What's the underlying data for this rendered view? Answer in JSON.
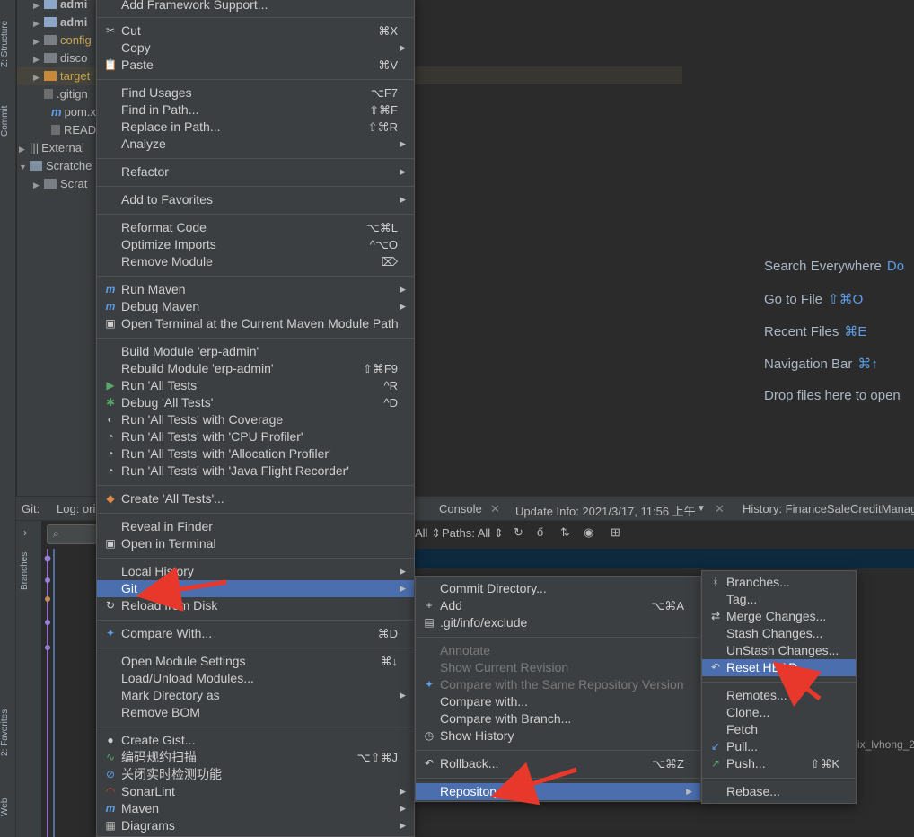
{
  "left_strip": {
    "structure_tab": "Z: Structure",
    "commit_tab": "Commit",
    "favorites_tab": "2: Favorites",
    "web_tab": "Web"
  },
  "tree": [
    {
      "label": "admi",
      "type": "module"
    },
    {
      "label": "admi",
      "type": "module"
    },
    {
      "label": "config",
      "type": "folder"
    },
    {
      "label": "disco",
      "type": "folder"
    },
    {
      "label": "target",
      "type": "folder"
    },
    {
      "label": ".gitign",
      "type": "file"
    },
    {
      "label": "pom.x",
      "type": "maven"
    },
    {
      "label": "READ",
      "type": "file"
    },
    {
      "label": "External",
      "type": "lib"
    },
    {
      "label": "Scratche",
      "type": "scratch"
    },
    {
      "label": "Scrat",
      "type": "folder"
    }
  ],
  "welcome": [
    {
      "label": "Search Everywhere",
      "shortcut": "Do"
    },
    {
      "label": "Go to File",
      "shortcut": "⇧⌘O"
    },
    {
      "label": "Recent Files",
      "shortcut": "⌘E"
    },
    {
      "label": "Navigation Bar",
      "shortcut": "⌘↑"
    },
    {
      "label": "Drop files here to open",
      "shortcut": ""
    }
  ],
  "bottom": {
    "git": "Git:",
    "log": "Log: ori",
    "console": "Console",
    "update_info": "Update Info: 2021/3/17, 11:56 上午",
    "history": "History: FinanceSaleCreditManag",
    "branches_tab": "Branches",
    "filter_all": "All",
    "paths": "Paths: All",
    "branch_label": "ix_lvhong_2"
  },
  "context_menu": {
    "header": "Add Framework Support...",
    "items": [
      {
        "label": "Cut",
        "shortcut": "⌘X",
        "icon": "✂"
      },
      {
        "label": "Copy",
        "submenu": true
      },
      {
        "label": "Paste",
        "shortcut": "⌘V",
        "icon": "📋"
      },
      {
        "label": "Find Usages",
        "shortcut": "⌥F7"
      },
      {
        "label": "Find in Path...",
        "shortcut": "⇧⌘F"
      },
      {
        "label": "Replace in Path...",
        "shortcut": "⇧⌘R"
      },
      {
        "label": "Analyze",
        "submenu": true
      },
      {
        "label": "Refactor",
        "submenu": true
      },
      {
        "label": "Add to Favorites",
        "submenu": true
      },
      {
        "label": "Reformat Code",
        "shortcut": "⌥⌘L"
      },
      {
        "label": "Optimize Imports",
        "shortcut": "^⌥O"
      },
      {
        "label": "Remove Module",
        "shortcut": "⌦"
      },
      {
        "label": "Run Maven",
        "submenu": true,
        "icon": "m"
      },
      {
        "label": "Debug Maven",
        "submenu": true,
        "icon": "m"
      },
      {
        "label": "Open Terminal at the Current Maven Module Path",
        "icon": "▣"
      },
      {
        "label": "Build Module 'erp-admin'"
      },
      {
        "label": "Rebuild Module 'erp-admin'",
        "shortcut": "⇧⌘F9"
      },
      {
        "label": "Run 'All Tests'",
        "shortcut": "^R",
        "icon": "▶"
      },
      {
        "label": "Debug 'All Tests'",
        "shortcut": "^D",
        "icon": "✱"
      },
      {
        "label": "Run 'All Tests' with Coverage",
        "icon": "◐"
      },
      {
        "label": "Run 'All Tests' with 'CPU Profiler'",
        "icon": "◔"
      },
      {
        "label": "Run 'All Tests' with 'Allocation Profiler'",
        "icon": "◔"
      },
      {
        "label": "Run 'All Tests' with 'Java Flight Recorder'",
        "icon": "◔"
      },
      {
        "label": "Create 'All Tests'...",
        "icon": "◆"
      },
      {
        "label": "Reveal in Finder"
      },
      {
        "label": "Open in Terminal",
        "icon": "▣"
      },
      {
        "label": "Local History",
        "submenu": true
      },
      {
        "label": "Git",
        "submenu": true,
        "selected": true
      },
      {
        "label": "Reload from Disk",
        "icon": "↻"
      },
      {
        "label": "Compare With...",
        "shortcut": "⌘D",
        "icon": "✦"
      },
      {
        "label": "Open Module Settings",
        "shortcut": "⌘↓"
      },
      {
        "label": "Load/Unload Modules..."
      },
      {
        "label": "Mark Directory as",
        "submenu": true
      },
      {
        "label": "Remove BOM"
      },
      {
        "label": "Create Gist...",
        "icon": "●"
      },
      {
        "label": "编码规约扫描",
        "shortcut": "⌥⇧⌘J",
        "icon": "∿"
      },
      {
        "label": "关闭实时检测功能",
        "icon": "⊘"
      },
      {
        "label": "SonarLint",
        "submenu": true,
        "icon": "◠"
      },
      {
        "label": "Maven",
        "submenu": true,
        "icon": "m"
      },
      {
        "label": "Diagrams",
        "submenu": true,
        "icon": "▦"
      }
    ]
  },
  "git_menu": {
    "items": [
      {
        "label": "Commit Directory..."
      },
      {
        "label": "Add",
        "shortcut": "⌥⌘A",
        "icon": "+"
      },
      {
        "label": ".git/info/exclude",
        "icon": "▤"
      },
      {
        "label": "Annotate",
        "disabled": true
      },
      {
        "label": "Show Current Revision",
        "disabled": true
      },
      {
        "label": "Compare with the Same Repository Version",
        "disabled": true,
        "icon": "✦"
      },
      {
        "label": "Compare with...",
        "disabled": false
      },
      {
        "label": "Compare with Branch..."
      },
      {
        "label": "Show History",
        "icon": "◷"
      },
      {
        "label": "Rollback...",
        "shortcut": "⌥⌘Z",
        "icon": "↶"
      },
      {
        "label": "Repository",
        "submenu": true,
        "selected": true
      }
    ]
  },
  "repo_menu": {
    "items": [
      {
        "label": "Branches...",
        "icon": "ᚼ"
      },
      {
        "label": "Tag..."
      },
      {
        "label": "Merge Changes...",
        "icon": "⇄"
      },
      {
        "label": "Stash Changes..."
      },
      {
        "label": "UnStash Changes..."
      },
      {
        "label": "Reset HEAD...",
        "icon": "↶",
        "selected": true
      },
      {
        "label": "Remotes..."
      },
      {
        "label": "Clone..."
      },
      {
        "label": "Fetch"
      },
      {
        "label": "Pull...",
        "icon": "↙"
      },
      {
        "label": "Push...",
        "shortcut": "⇧⌘K",
        "icon": "↗"
      },
      {
        "label": "Rebase..."
      }
    ]
  },
  "colors": {
    "accent": "#4b6eaf",
    "annotation_arrow": "#e8382c",
    "menu_bg": "#3c3f41"
  }
}
